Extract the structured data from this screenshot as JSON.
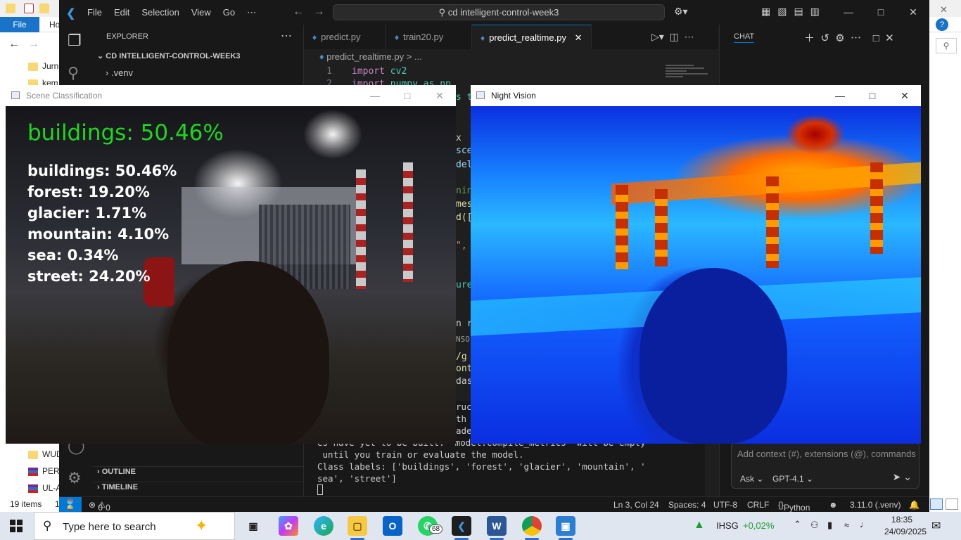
{
  "file_explorer": {
    "ribbon_file": "File",
    "ribbon_home": "Ho",
    "items": [
      {
        "label": "Jurn",
        "type": "folder"
      },
      {
        "label": "kem",
        "type": "folder"
      },
      {
        "label": "WUD",
        "type": "folder"
      },
      {
        "label": "PERA",
        "type": "rar"
      },
      {
        "label": "UL-A",
        "type": "rar"
      }
    ],
    "status_count": "19 items",
    "status_extra": "1"
  },
  "vscode": {
    "menu": [
      "File",
      "Edit",
      "Selection",
      "View",
      "Go",
      "⋯"
    ],
    "search": "cd intelligent-control-week3",
    "explorer": {
      "title": "EXPLORER",
      "folder": "CD INTELLIGENT-CONTROL-WEEK3",
      "venv": ".venv",
      "outline": "OUTLINE",
      "timeline": "TIMELINE"
    },
    "tabs": [
      {
        "label": "predict.py",
        "active": false
      },
      {
        "label": "train20.py",
        "active": false
      },
      {
        "label": "predict_realtime.py",
        "active": true
      }
    ],
    "breadcrumb": "predict_realtime.py > ...",
    "code_lines": [
      {
        "num": "1",
        "kw": "import",
        "mod": "cv2"
      },
      {
        "num": "2",
        "kw": "import",
        "mod": "numpy as np"
      }
    ],
    "visible_fragments": {
      "f1": "s t",
      "f2": "x",
      "f3": "sce",
      "f4": "del",
      "f5": "nin",
      "f6": "mes",
      "f7": "d([",
      "f8": "\",",
      "f9": "ure",
      "f10": "n r",
      "f11": "NSO",
      "f12": "/g",
      "f13": "ont",
      "f14": "das"
    },
    "terminal_lines": [
      "ruc",
      "th",
      "ade",
      "es have yet to be built. `model.compile_metrics` will be empty",
      " until you train or evaluate the model.",
      "Class labels: ['buildings', 'forest', 'glacier', 'mountain', '",
      "sea', 'street']"
    ],
    "chat": {
      "title": "CHAT",
      "placeholder": "Add context (#), extensions (@), commands",
      "mode": "Ask",
      "model": "GPT-4.1"
    },
    "status_bar": {
      "problems": "0",
      "warnings": "0",
      "position": "Ln 3, Col 24",
      "spaces": "Spaces: 4",
      "encoding": "UTF-8",
      "eol": "CRLF",
      "language": "Python",
      "interpreter": "3.11.0 (.venv)"
    }
  },
  "scene_window": {
    "title": "Scene Classification",
    "main_prediction": "buildings: 50.46%",
    "predictions": [
      "buildings: 50.46%",
      "forest: 19.20%",
      "glacier: 1.71%",
      "mountain: 4.10%",
      "sea: 0.34%",
      "street: 24.20%"
    ],
    "colors": {
      "main": "#1fd620",
      "list": "#ffffff"
    }
  },
  "night_window": {
    "title": "Night Vision",
    "colormap": "jet"
  },
  "taskbar": {
    "search_placeholder": "Type here to search",
    "whatsapp_badge": "68",
    "stock_name": "IHSG",
    "stock_change": "+0,02%",
    "stock_color": "#1a9e2f",
    "time": "18:35",
    "date": "24/09/2025"
  }
}
